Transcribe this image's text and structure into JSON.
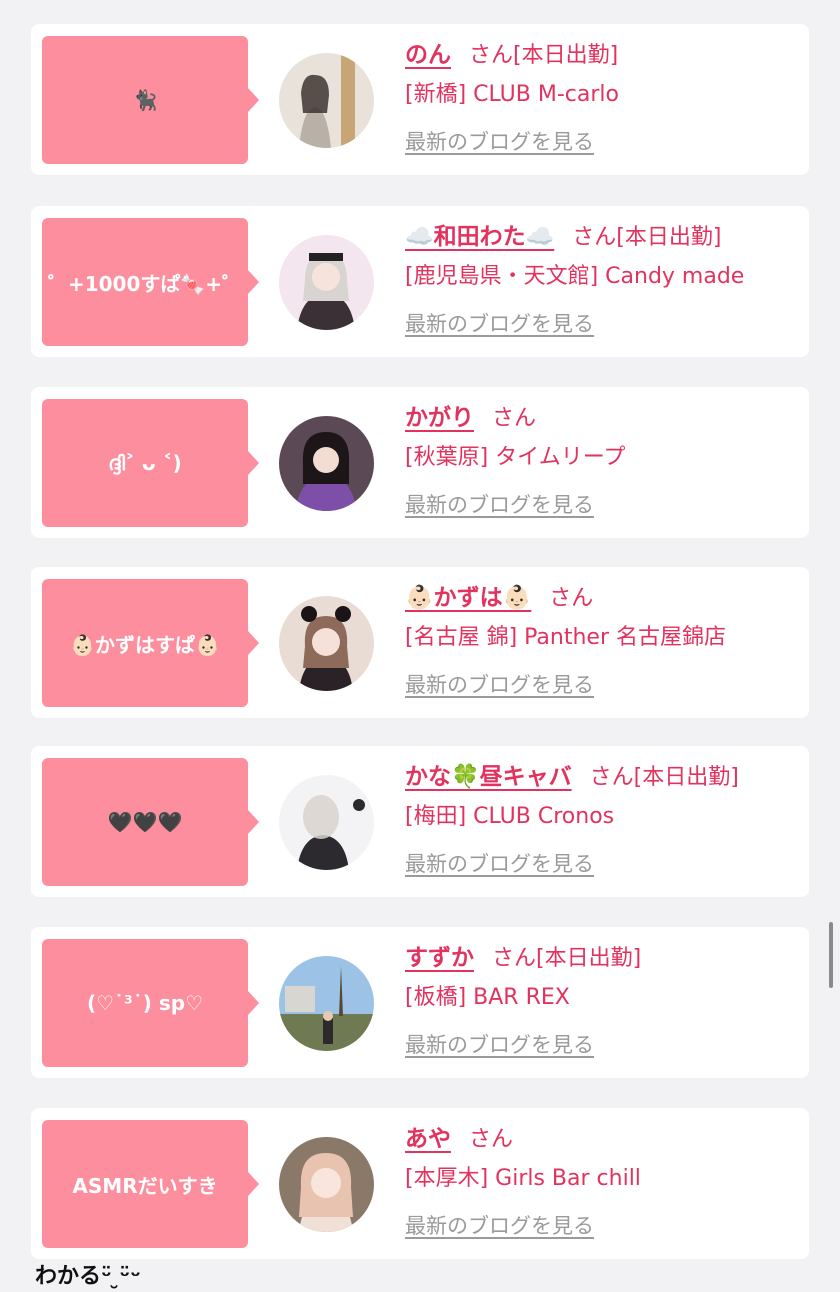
{
  "entries": [
    {
      "tagline": "🐈‍⬛",
      "name": "のん",
      "honorific": "さん",
      "status": "[本日出勤]",
      "shop": "[新橋] CLUB M-carlo",
      "blog_link": "最新のブログを見る",
      "avatar_colors": [
        "#e8e2da",
        "#b9b1a7"
      ]
    },
    {
      "tagline": "゜+1000すぱ🍬+゜",
      "name": "☁️和田わた☁️",
      "honorific": "さん",
      "status": "[本日出勤]",
      "shop": "[鹿児島県・天文館] Candy made",
      "blog_link": "最新のブログを見る",
      "avatar_colors": [
        "#f4e6ee",
        "#3a3035"
      ]
    },
    {
      "tagline": "ദ്ദി˃ ᴗ ˂)",
      "name": "かがり",
      "honorific": "さん",
      "status": "",
      "shop": "[秋葉原] タイムリープ",
      "blog_link": "最新のブログを見る",
      "avatar_colors": [
        "#5b4a55",
        "#7e4fa8"
      ]
    },
    {
      "tagline": "👶🏻かずはすぱ👶🏻",
      "name": "👶🏻かずは👶🏻",
      "honorific": "さん",
      "status": "",
      "shop": "[名古屋 錦] Panther 名古屋錦店",
      "blog_link": "最新のブログを見る",
      "avatar_colors": [
        "#e9dcd4",
        "#2a2226"
      ]
    },
    {
      "tagline": "🖤🖤🖤",
      "name": "かな🍀昼キャバ",
      "honorific": "さん",
      "status": "[本日出勤]",
      "shop": "[梅田] CLUB Cronos",
      "blog_link": "最新のブログを見る",
      "avatar_colors": [
        "#f3f3f5",
        "#2c2a2e"
      ]
    },
    {
      "tagline": "(♡˙³˙) sp♡",
      "name": "すずか",
      "honorific": "さん",
      "status": "[本日出勤]",
      "shop": "[板橋] BAR REX",
      "blog_link": "最新のブログを見る",
      "avatar_colors": [
        "#9cc2e6",
        "#6f7a52"
      ]
    },
    {
      "tagline": "ASMRだいすき",
      "name": "あや",
      "honorific": "さん",
      "status": "",
      "shop": "[本厚木] Girls Bar chill",
      "blog_link": "最新のブログを見る",
      "avatar_colors": [
        "#8a7868",
        "#e8c4b0"
      ]
    }
  ],
  "bottom_text": "わかるᵕ̈ ̮ᵕ̈ᵕ"
}
